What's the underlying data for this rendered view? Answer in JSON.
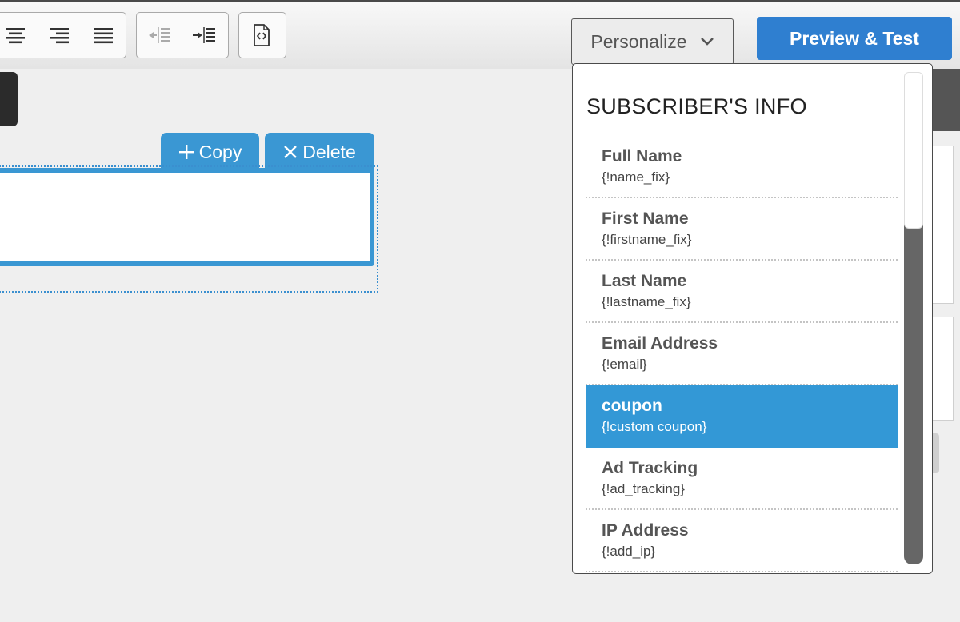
{
  "toolbar": {
    "align_group": [
      "align-center-icon",
      "align-right-icon",
      "align-justify-icon"
    ],
    "indent_group": [
      "outdent-icon",
      "indent-icon"
    ],
    "source_icon": "source-code-icon",
    "personalize_label": "Personalize",
    "preview_label": "Preview & Test"
  },
  "block_actions": {
    "copy_label": "Copy",
    "delete_label": "Delete"
  },
  "personalize_menu": {
    "heading": "SUBSCRIBER'S INFO",
    "items": [
      {
        "name": "Full Name",
        "tag": "{!name_fix}",
        "selected": false
      },
      {
        "name": "First Name",
        "tag": "{!firstname_fix}",
        "selected": false
      },
      {
        "name": "Last Name",
        "tag": "{!lastname_fix}",
        "selected": false
      },
      {
        "name": "Email Address",
        "tag": "{!email}",
        "selected": false
      },
      {
        "name": "coupon",
        "tag": "{!custom coupon}",
        "selected": true
      },
      {
        "name": "Ad Tracking",
        "tag": "{!ad_tracking}",
        "selected": false
      },
      {
        "name": "IP Address",
        "tag": "{!add_ip}",
        "selected": false
      }
    ]
  },
  "colors": {
    "primary_button": "#2f7fd0",
    "block_accent": "#3a97d3",
    "selected_item": "#3398d6"
  }
}
